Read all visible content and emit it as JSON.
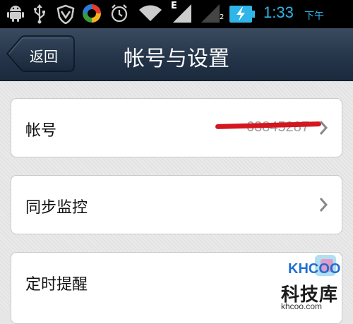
{
  "status_bar": {
    "time": "1:33",
    "ampm": "下午",
    "signal_label": "E",
    "sim_index": "2",
    "icons": [
      "android-debug-icon",
      "usb-icon",
      "vpn-shield-icon",
      "app-colorwheel-icon",
      "alarm-clock-icon",
      "wifi-icon",
      "signal-e-icon",
      "signal-2-icon",
      "battery-charging-icon"
    ],
    "accent_color": "#2fb5e8"
  },
  "header": {
    "back_label": "返回",
    "title": "帐号与设置"
  },
  "settings": {
    "items": [
      {
        "label": "帐号",
        "value": "63845287"
      },
      {
        "label": "同步监控"
      },
      {
        "label": "定时提醒"
      }
    ]
  },
  "watermark": {
    "logo_text": "KHCOO",
    "name": "科技库",
    "url": "khcoo.com"
  }
}
